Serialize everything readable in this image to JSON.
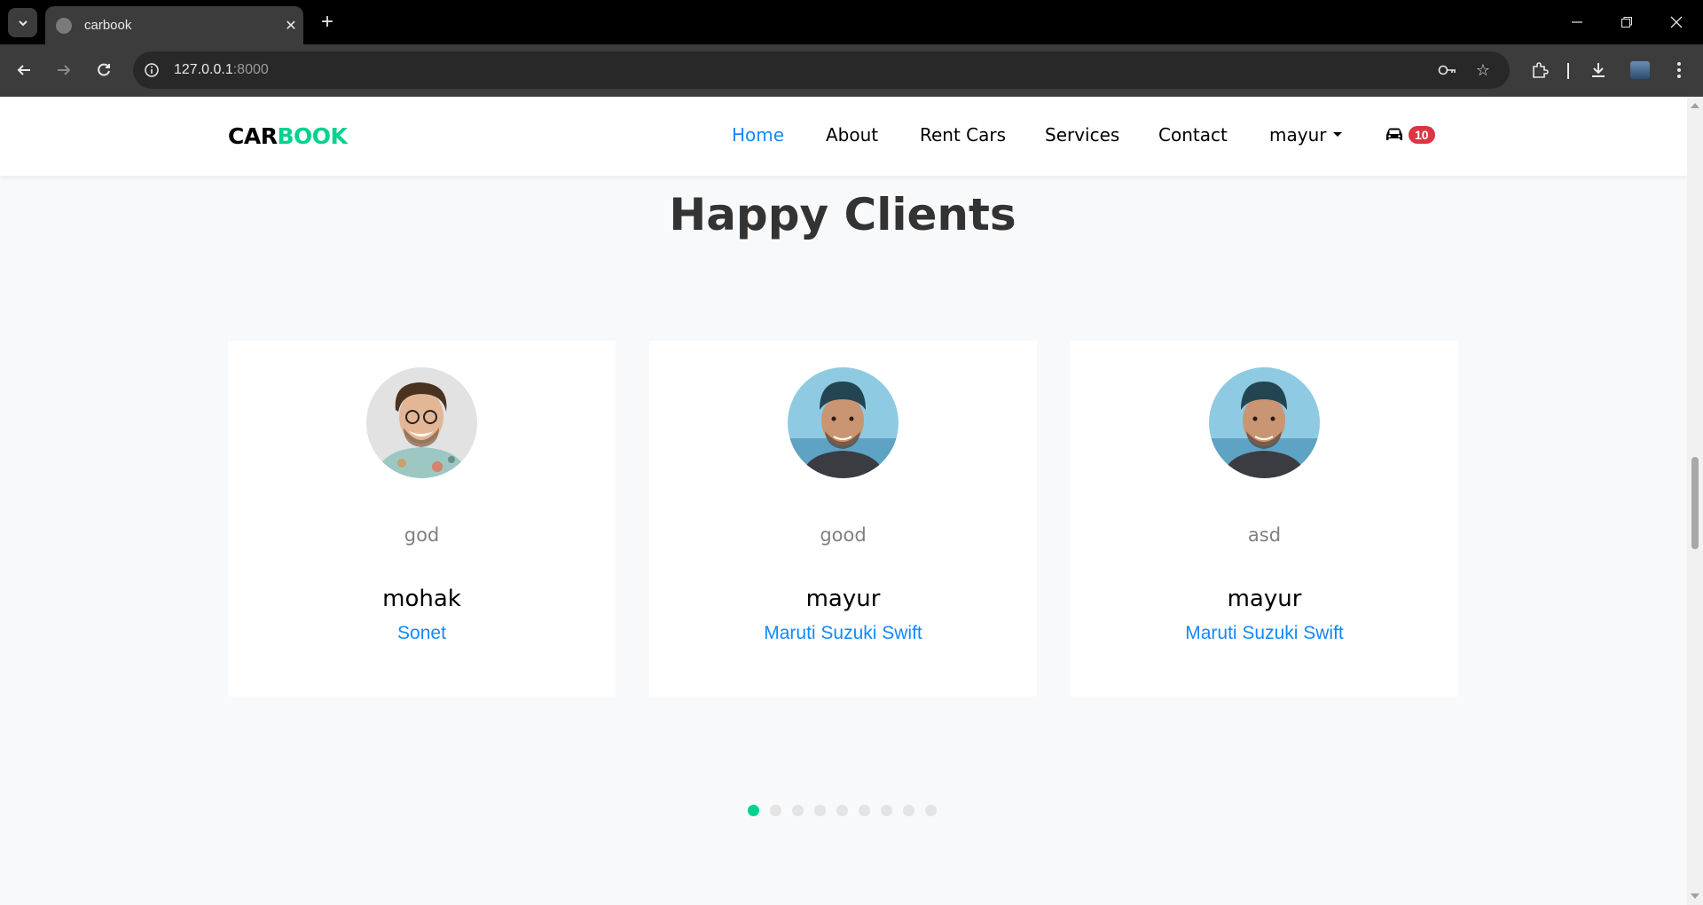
{
  "browser": {
    "tab_title": "carbook",
    "url_host": "127.0.0.1",
    "url_port": ":8000"
  },
  "navbar": {
    "brand_part1": "CAR",
    "brand_part2": "BOOK",
    "links": [
      "Home",
      "About",
      "Rent Cars",
      "Services",
      "Contact"
    ],
    "user": "mayur",
    "cart_count": "10"
  },
  "section": {
    "title": "Happy Clients"
  },
  "testimonials": [
    {
      "review": "god",
      "name": "mohak",
      "car": "Sonet"
    },
    {
      "review": "good",
      "name": "mayur",
      "car": "Maruti Suzuki Swift"
    },
    {
      "review": "asd",
      "name": "mayur",
      "car": "Maruti Suzuki Swift"
    }
  ],
  "carousel": {
    "dot_count": 9,
    "active_index": 0
  },
  "colors": {
    "accent_green": "#01d28e",
    "link_blue": "#1089ff",
    "badge_red": "#dc3545"
  }
}
